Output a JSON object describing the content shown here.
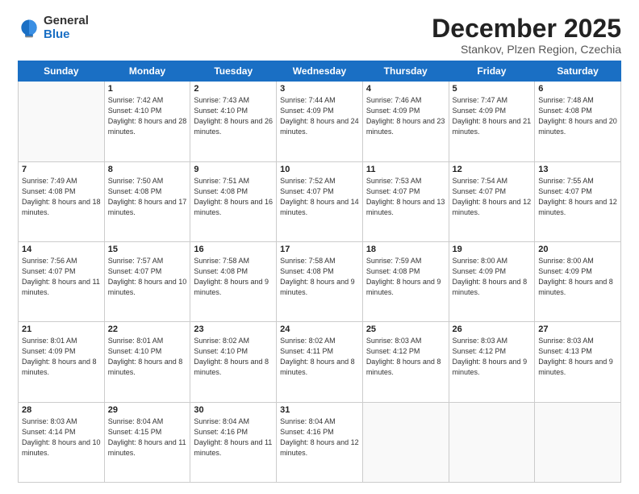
{
  "logo": {
    "general": "General",
    "blue": "Blue"
  },
  "header": {
    "month": "December 2025",
    "location": "Stankov, Plzen Region, Czechia"
  },
  "weekdays": [
    "Sunday",
    "Monday",
    "Tuesday",
    "Wednesday",
    "Thursday",
    "Friday",
    "Saturday"
  ],
  "weeks": [
    [
      {
        "day": "",
        "sunrise": "",
        "sunset": "",
        "daylight": ""
      },
      {
        "day": "1",
        "sunrise": "Sunrise: 7:42 AM",
        "sunset": "Sunset: 4:10 PM",
        "daylight": "Daylight: 8 hours and 28 minutes."
      },
      {
        "day": "2",
        "sunrise": "Sunrise: 7:43 AM",
        "sunset": "Sunset: 4:10 PM",
        "daylight": "Daylight: 8 hours and 26 minutes."
      },
      {
        "day": "3",
        "sunrise": "Sunrise: 7:44 AM",
        "sunset": "Sunset: 4:09 PM",
        "daylight": "Daylight: 8 hours and 24 minutes."
      },
      {
        "day": "4",
        "sunrise": "Sunrise: 7:46 AM",
        "sunset": "Sunset: 4:09 PM",
        "daylight": "Daylight: 8 hours and 23 minutes."
      },
      {
        "day": "5",
        "sunrise": "Sunrise: 7:47 AM",
        "sunset": "Sunset: 4:09 PM",
        "daylight": "Daylight: 8 hours and 21 minutes."
      },
      {
        "day": "6",
        "sunrise": "Sunrise: 7:48 AM",
        "sunset": "Sunset: 4:08 PM",
        "daylight": "Daylight: 8 hours and 20 minutes."
      }
    ],
    [
      {
        "day": "7",
        "sunrise": "Sunrise: 7:49 AM",
        "sunset": "Sunset: 4:08 PM",
        "daylight": "Daylight: 8 hours and 18 minutes."
      },
      {
        "day": "8",
        "sunrise": "Sunrise: 7:50 AM",
        "sunset": "Sunset: 4:08 PM",
        "daylight": "Daylight: 8 hours and 17 minutes."
      },
      {
        "day": "9",
        "sunrise": "Sunrise: 7:51 AM",
        "sunset": "Sunset: 4:08 PM",
        "daylight": "Daylight: 8 hours and 16 minutes."
      },
      {
        "day": "10",
        "sunrise": "Sunrise: 7:52 AM",
        "sunset": "Sunset: 4:07 PM",
        "daylight": "Daylight: 8 hours and 14 minutes."
      },
      {
        "day": "11",
        "sunrise": "Sunrise: 7:53 AM",
        "sunset": "Sunset: 4:07 PM",
        "daylight": "Daylight: 8 hours and 13 minutes."
      },
      {
        "day": "12",
        "sunrise": "Sunrise: 7:54 AM",
        "sunset": "Sunset: 4:07 PM",
        "daylight": "Daylight: 8 hours and 12 minutes."
      },
      {
        "day": "13",
        "sunrise": "Sunrise: 7:55 AM",
        "sunset": "Sunset: 4:07 PM",
        "daylight": "Daylight: 8 hours and 12 minutes."
      }
    ],
    [
      {
        "day": "14",
        "sunrise": "Sunrise: 7:56 AM",
        "sunset": "Sunset: 4:07 PM",
        "daylight": "Daylight: 8 hours and 11 minutes."
      },
      {
        "day": "15",
        "sunrise": "Sunrise: 7:57 AM",
        "sunset": "Sunset: 4:07 PM",
        "daylight": "Daylight: 8 hours and 10 minutes."
      },
      {
        "day": "16",
        "sunrise": "Sunrise: 7:58 AM",
        "sunset": "Sunset: 4:08 PM",
        "daylight": "Daylight: 8 hours and 9 minutes."
      },
      {
        "day": "17",
        "sunrise": "Sunrise: 7:58 AM",
        "sunset": "Sunset: 4:08 PM",
        "daylight": "Daylight: 8 hours and 9 minutes."
      },
      {
        "day": "18",
        "sunrise": "Sunrise: 7:59 AM",
        "sunset": "Sunset: 4:08 PM",
        "daylight": "Daylight: 8 hours and 9 minutes."
      },
      {
        "day": "19",
        "sunrise": "Sunrise: 8:00 AM",
        "sunset": "Sunset: 4:09 PM",
        "daylight": "Daylight: 8 hours and 8 minutes."
      },
      {
        "day": "20",
        "sunrise": "Sunrise: 8:00 AM",
        "sunset": "Sunset: 4:09 PM",
        "daylight": "Daylight: 8 hours and 8 minutes."
      }
    ],
    [
      {
        "day": "21",
        "sunrise": "Sunrise: 8:01 AM",
        "sunset": "Sunset: 4:09 PM",
        "daylight": "Daylight: 8 hours and 8 minutes."
      },
      {
        "day": "22",
        "sunrise": "Sunrise: 8:01 AM",
        "sunset": "Sunset: 4:10 PM",
        "daylight": "Daylight: 8 hours and 8 minutes."
      },
      {
        "day": "23",
        "sunrise": "Sunrise: 8:02 AM",
        "sunset": "Sunset: 4:10 PM",
        "daylight": "Daylight: 8 hours and 8 minutes."
      },
      {
        "day": "24",
        "sunrise": "Sunrise: 8:02 AM",
        "sunset": "Sunset: 4:11 PM",
        "daylight": "Daylight: 8 hours and 8 minutes."
      },
      {
        "day": "25",
        "sunrise": "Sunrise: 8:03 AM",
        "sunset": "Sunset: 4:12 PM",
        "daylight": "Daylight: 8 hours and 8 minutes."
      },
      {
        "day": "26",
        "sunrise": "Sunrise: 8:03 AM",
        "sunset": "Sunset: 4:12 PM",
        "daylight": "Daylight: 8 hours and 9 minutes."
      },
      {
        "day": "27",
        "sunrise": "Sunrise: 8:03 AM",
        "sunset": "Sunset: 4:13 PM",
        "daylight": "Daylight: 8 hours and 9 minutes."
      }
    ],
    [
      {
        "day": "28",
        "sunrise": "Sunrise: 8:03 AM",
        "sunset": "Sunset: 4:14 PM",
        "daylight": "Daylight: 8 hours and 10 minutes."
      },
      {
        "day": "29",
        "sunrise": "Sunrise: 8:04 AM",
        "sunset": "Sunset: 4:15 PM",
        "daylight": "Daylight: 8 hours and 11 minutes."
      },
      {
        "day": "30",
        "sunrise": "Sunrise: 8:04 AM",
        "sunset": "Sunset: 4:16 PM",
        "daylight": "Daylight: 8 hours and 11 minutes."
      },
      {
        "day": "31",
        "sunrise": "Sunrise: 8:04 AM",
        "sunset": "Sunset: 4:16 PM",
        "daylight": "Daylight: 8 hours and 12 minutes."
      },
      {
        "day": "",
        "sunrise": "",
        "sunset": "",
        "daylight": ""
      },
      {
        "day": "",
        "sunrise": "",
        "sunset": "",
        "daylight": ""
      },
      {
        "day": "",
        "sunrise": "",
        "sunset": "",
        "daylight": ""
      }
    ]
  ]
}
